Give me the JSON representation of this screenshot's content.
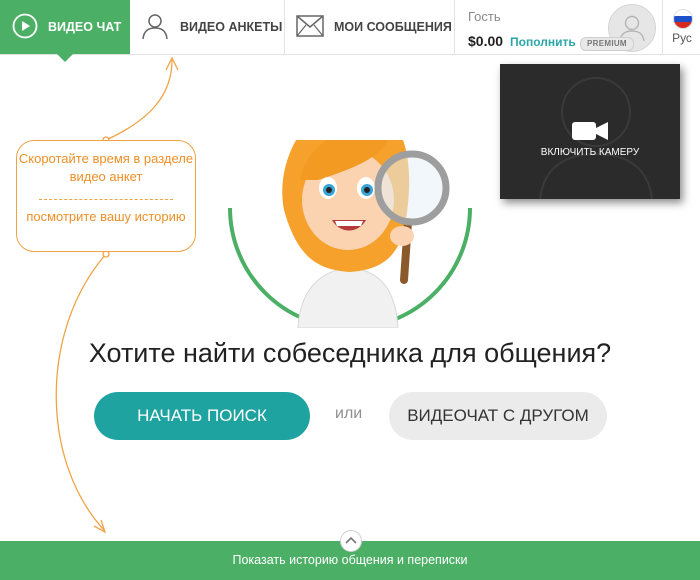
{
  "nav": {
    "tabs": [
      {
        "label": "ВИДЕО ЧАТ",
        "icon": "play-circle-icon",
        "active": true
      },
      {
        "label": "ВИДЕО АНКЕТЫ",
        "icon": "user-outline-icon",
        "active": false
      },
      {
        "label": "МОИ СООБЩЕНИЯ",
        "icon": "envelope-icon",
        "active": false
      }
    ]
  },
  "account": {
    "guest_label": "Гость",
    "balance": "$0.00",
    "topup_label": "Пополнить",
    "premium_badge": "PREMIUM"
  },
  "language": {
    "label": "Рус",
    "flag_icon": "russia-flag-icon"
  },
  "hint": {
    "line1": "Скоротайте время в разделе видео анкет",
    "line2": "посмотрите вашу историю"
  },
  "camera": {
    "label": "ВКЛЮЧИТЬ КАМЕРУ",
    "icon": "video-camera-icon"
  },
  "main": {
    "headline": "Хотите найти собеседника для общения?",
    "start_button": "НАЧАТЬ ПОИСК",
    "or_text": "или",
    "friend_button": "ВИДЕОЧАТ С ДРУГОМ"
  },
  "footer": {
    "label": "Показать историю общения и переписки",
    "icon": "chevron-up-icon"
  },
  "colors": {
    "brand_green": "#4caf66",
    "teal": "#1fa3a0",
    "orange": "#f0a346",
    "dark_panel": "#2b2b2b"
  }
}
